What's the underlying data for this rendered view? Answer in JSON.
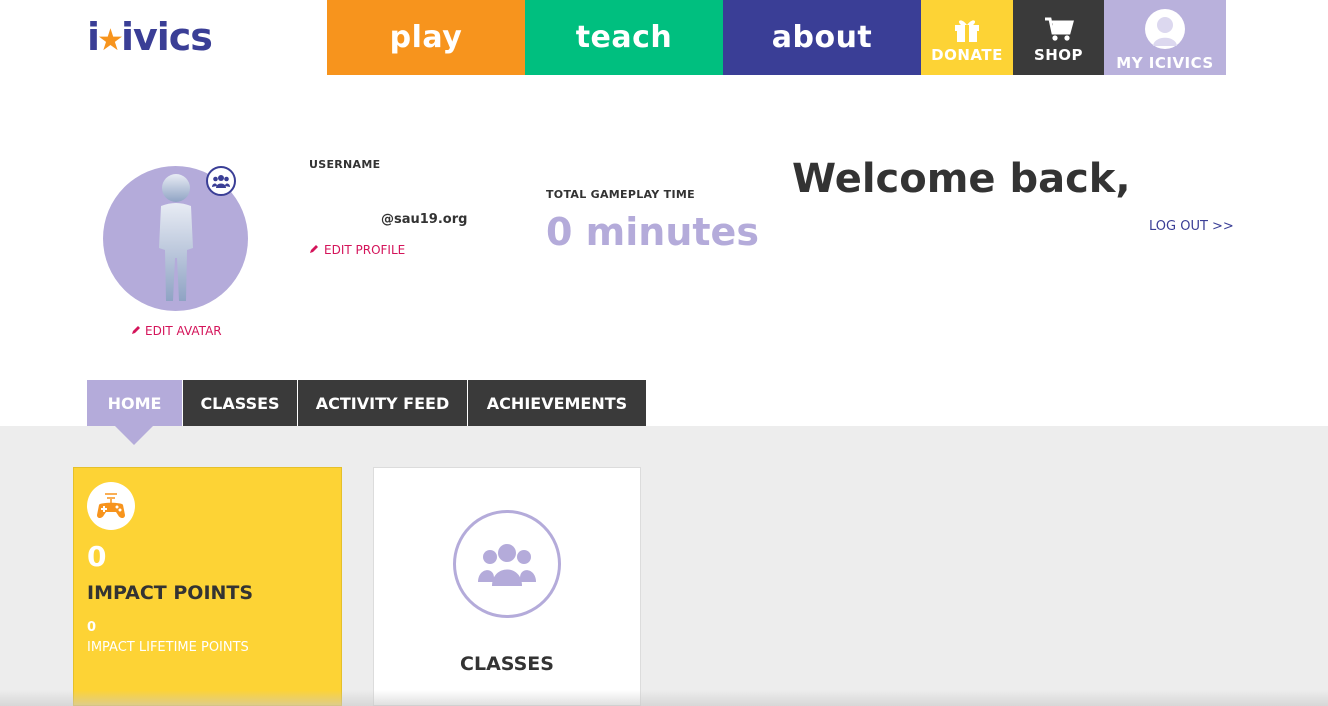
{
  "header": {
    "logo_text": "iCivics",
    "nav": {
      "play": "play",
      "teach": "teach",
      "about": "about",
      "donate": "DONATE",
      "shop": "SHOP",
      "my_icivics": "MY ICIVICS"
    }
  },
  "profile": {
    "username_label": "USERNAME",
    "username_value": "@sau19.org",
    "edit_profile": "EDIT PROFILE",
    "edit_avatar": "EDIT AVATAR",
    "gameplay_label": "TOTAL GAMEPLAY TIME",
    "gameplay_value": "0 minutes",
    "welcome": "Welcome back,",
    "logout": "LOG OUT >>"
  },
  "tabs": {
    "home": "HOME",
    "classes": "CLASSES",
    "activity_feed": "ACTIVITY FEED",
    "achievements": "ACHIEVEMENTS"
  },
  "cards": {
    "impact": {
      "points": "0",
      "label": "IMPACT POINTS",
      "lifetime_points": "0",
      "lifetime_label": "IMPACT LIFETIME POINTS"
    },
    "classes": {
      "label": "CLASSES"
    }
  },
  "colors": {
    "orange": "#f7941d",
    "green": "#00bf7f",
    "navy": "#3a3e96",
    "yellow": "#fdd335",
    "dark": "#3a3a3a",
    "lavender": "#b4abda",
    "pink": "#d4145a"
  },
  "icons": {
    "donate": "gift-icon",
    "shop": "cart-icon",
    "my_icivics": "user-avatar-icon",
    "avatar_badge": "group-icon",
    "edit": "pencil-icon",
    "impact": "gamepad-icon",
    "classes": "group-icon"
  }
}
